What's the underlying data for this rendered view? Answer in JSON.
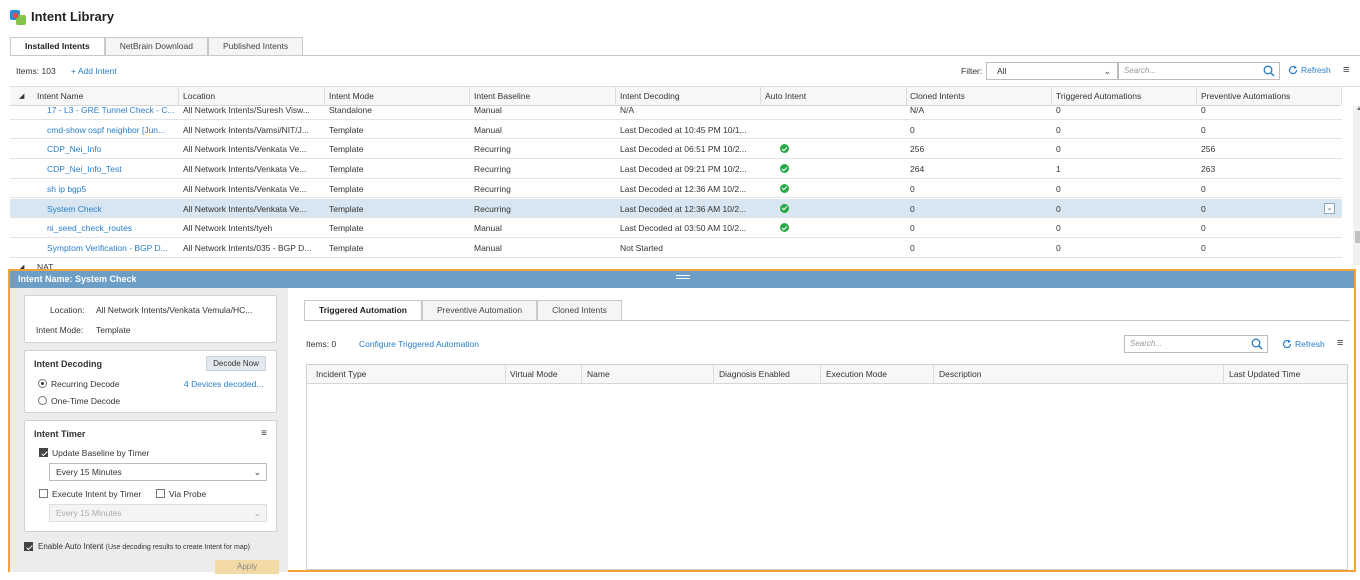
{
  "app": {
    "title": "Intent Library"
  },
  "main_tabs": [
    {
      "label": "Installed Intents",
      "active": true
    },
    {
      "label": "NetBrain Download",
      "active": false
    },
    {
      "label": "Published Intents",
      "active": false
    }
  ],
  "toolbar": {
    "items_count": "Items: 103",
    "add_label": "+ Add Intent",
    "filter_label": "Filter:",
    "filter_value": "All",
    "search_placeholder": "Search...",
    "refresh_label": "Refresh"
  },
  "grid": {
    "columns": [
      "Intent Name",
      "Location",
      "Intent Mode",
      "Intent Baseline",
      "Intent Decoding",
      "Auto Intent",
      "Cloned Intents",
      "Triggered Automations",
      "Preventive Automations"
    ],
    "rows": [
      {
        "name": "17 - L3 - GRE Tunnel Check - C...",
        "location": "All Network Intents/Suresh Visw...",
        "mode": "Standalone",
        "baseline": "Manual",
        "decoding": "N/A",
        "auto": false,
        "cloned": "N/A",
        "triggered": "0",
        "preventive": "0",
        "selected": false
      },
      {
        "name": "cmd-show ospf neighbor [Jun...",
        "location": "All Network Intents/Vamsi/NIT/J...",
        "mode": "Template",
        "baseline": "Manual",
        "decoding": "Last Decoded at 10:45 PM 10/1...",
        "auto": false,
        "cloned": "0",
        "triggered": "0",
        "preventive": "0",
        "selected": false
      },
      {
        "name": "CDP_Nei_Info",
        "location": "All Network Intents/Venkata Ve...",
        "mode": "Template",
        "baseline": "Recurring",
        "decoding": "Last Decoded at 06:51 PM 10/2...",
        "auto": true,
        "cloned": "256",
        "triggered": "0",
        "preventive": "256",
        "selected": false
      },
      {
        "name": "CDP_Nei_Info_Test",
        "location": "All Network Intents/Venkata Ve...",
        "mode": "Template",
        "baseline": "Recurring",
        "decoding": "Last Decoded at 09:21 PM 10/2...",
        "auto": true,
        "cloned": "264",
        "triggered": "1",
        "preventive": "263",
        "selected": false
      },
      {
        "name": "sh ip bgp5",
        "location": "All Network Intents/Venkata Ve...",
        "mode": "Template",
        "baseline": "Recurring",
        "decoding": "Last Decoded at 12:36 AM 10/2...",
        "auto": true,
        "cloned": "0",
        "triggered": "0",
        "preventive": "0",
        "selected": false
      },
      {
        "name": "System Check",
        "location": "All Network Intents/Venkata Ve...",
        "mode": "Template",
        "baseline": "Recurring",
        "decoding": "Last Decoded at 12:36 AM 10/2...",
        "auto": true,
        "cloned": "0",
        "triggered": "0",
        "preventive": "0",
        "selected": true
      },
      {
        "name": "ni_seed_check_routes",
        "location": "All Network Intents/tyeh",
        "mode": "Template",
        "baseline": "Manual",
        "decoding": "Last Decoded at 03:50 AM 10/2...",
        "auto": true,
        "cloned": "0",
        "triggered": "0",
        "preventive": "0",
        "selected": false
      },
      {
        "name": "Symptom Verification - BGP D...",
        "location": "All Network Intents/035 - BGP D...",
        "mode": "Template",
        "baseline": "Manual",
        "decoding": "Not Started",
        "auto": false,
        "cloned": "0",
        "triggered": "0",
        "preventive": "0",
        "selected": false
      }
    ],
    "group_label": "NAT"
  },
  "detail": {
    "title": "Intent Name: System Check",
    "location_label": "Location:",
    "location_value": "All Network Intents/Venkata Vemula/HC...",
    "mode_label": "Intent Mode:",
    "mode_value": "Template",
    "decoding": {
      "title": "Intent Decoding",
      "decode_now": "Decode Now",
      "recurring_label": "Recurring Decode",
      "recurring_selected": true,
      "onetime_label": "One-Time Decode",
      "devices_link": "4 Devices decoded..."
    },
    "timer": {
      "title": "Intent Timer",
      "update_label": "Update Baseline by Timer",
      "update_checked": true,
      "update_interval": "Every 15 Minutes",
      "execute_label": "Execute Intent by Timer",
      "execute_checked": false,
      "probe_label": "Via Probe",
      "probe_checked": false,
      "execute_interval": "Every 15 Minutes"
    },
    "auto_intent_label": "Enable Auto Intent",
    "auto_intent_hint": "(Use decoding results to create Intent for map)",
    "auto_intent_checked": true,
    "apply_label": "Apply"
  },
  "right": {
    "tabs": [
      {
        "label": "Triggered Automation",
        "active": true
      },
      {
        "label": "Preventive Automation",
        "active": false
      },
      {
        "label": "Cloned Intents",
        "active": false
      }
    ],
    "items_count": "Items: 0",
    "configure_label": "Configure Triggered Automation",
    "search_placeholder": "Search...",
    "refresh_label": "Refresh",
    "columns": [
      "Incident Type",
      "Virtual Mode",
      "Name",
      "Diagnosis Enabled",
      "Execution Mode",
      "Description",
      "Last Updated Time"
    ]
  },
  "colors": {
    "accent": "#2a7ec9",
    "detail_header": "#6d9ec5",
    "highlight_border": "#f0a336",
    "selected_row": "#d7e6f1",
    "ok_green": "#27a845"
  }
}
